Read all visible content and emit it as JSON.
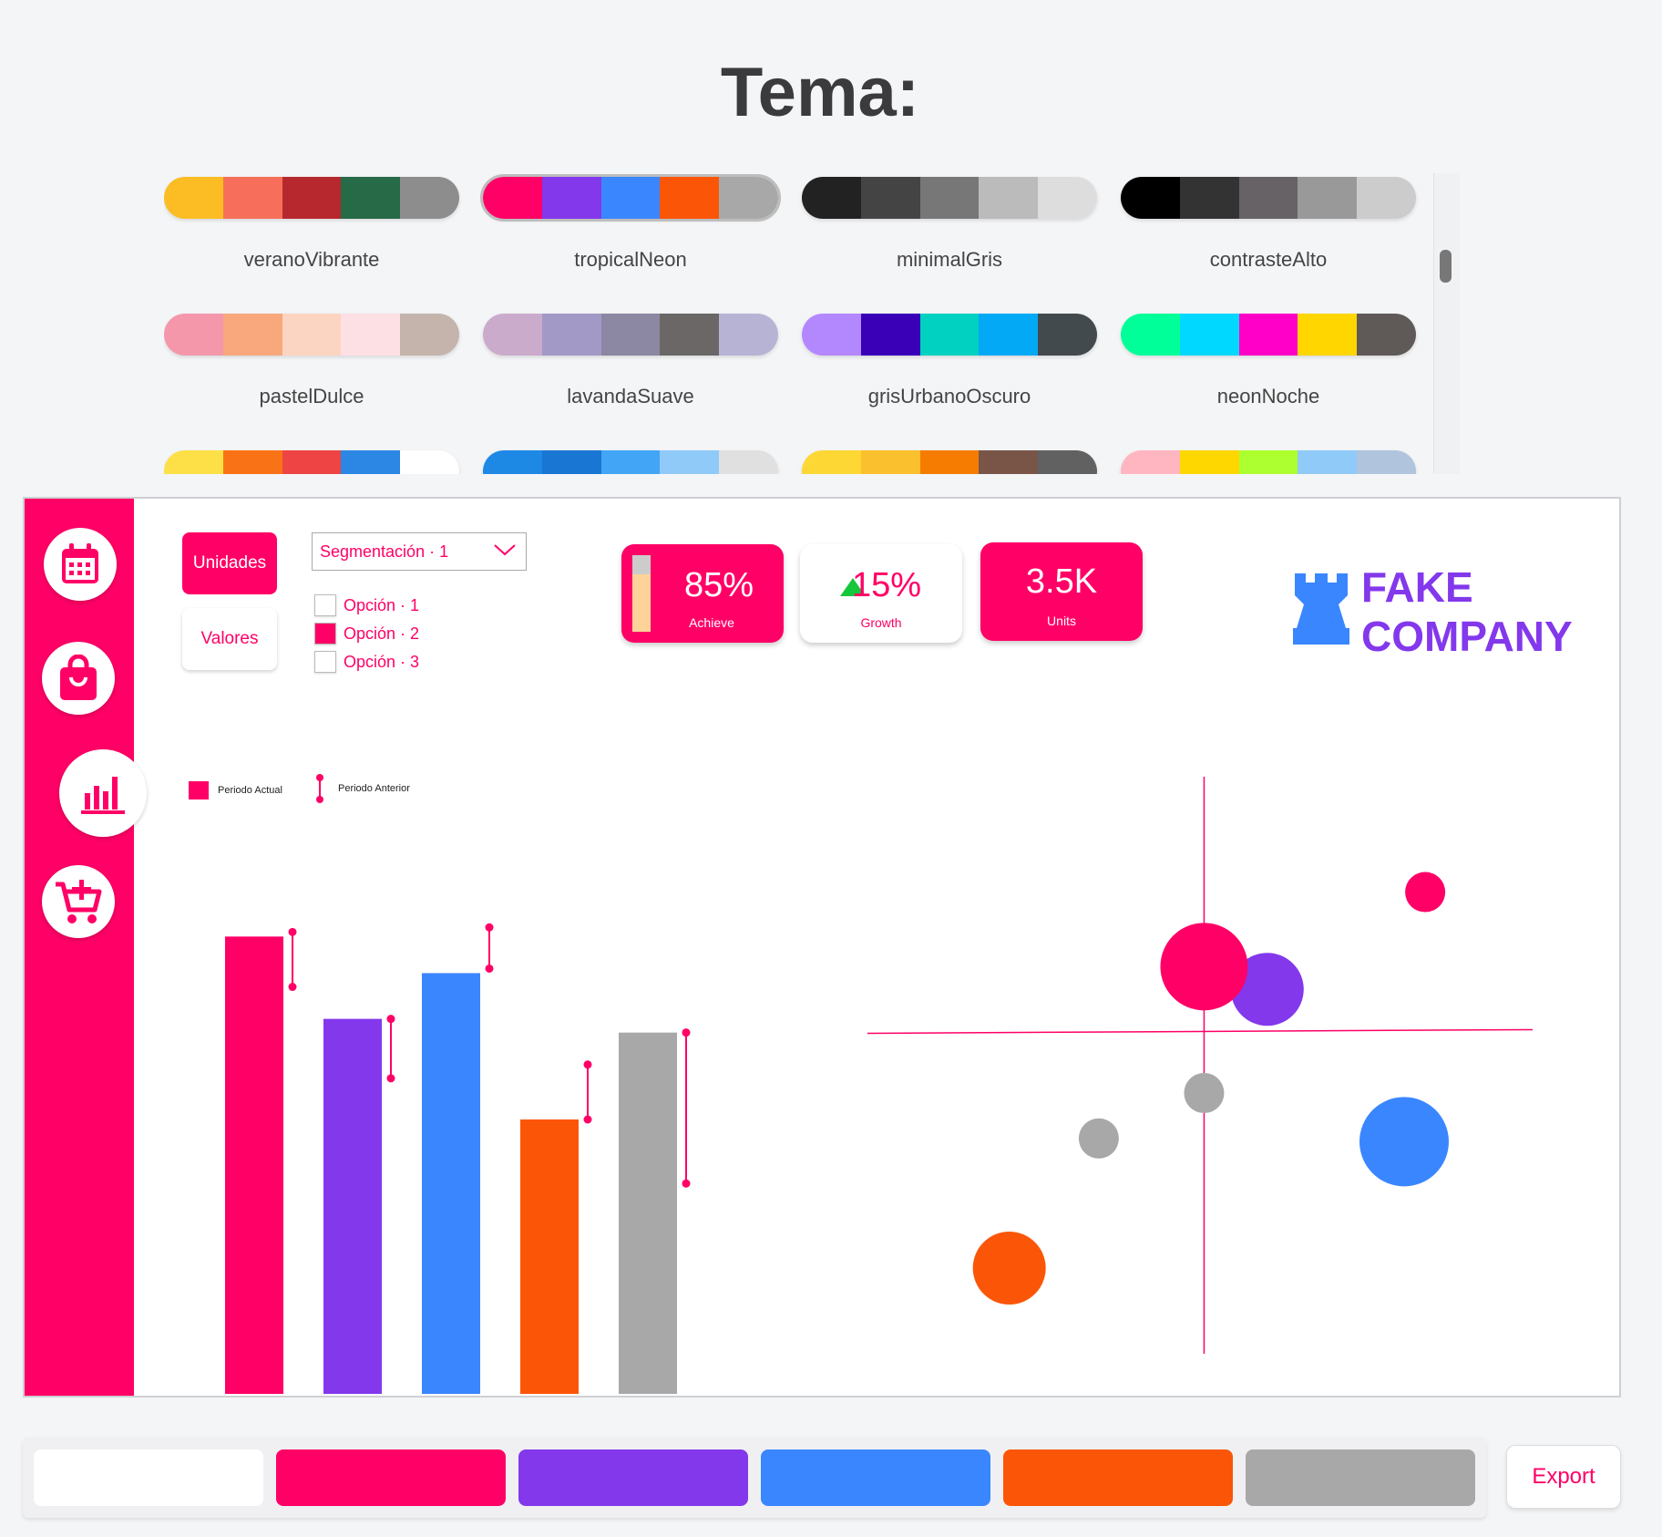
{
  "header": {
    "title": "Tema:"
  },
  "themes": [
    {
      "name": "veranoVibrante",
      "colors": [
        "#fbbd23",
        "#f76f5a",
        "#b7282e",
        "#276a47",
        "#8d8d8d"
      ]
    },
    {
      "name": "tropicalNeon",
      "colors": [
        "#ff0066",
        "#8338ec",
        "#3a86ff",
        "#fb5607",
        "#a8a8a8"
      ],
      "selected": true
    },
    {
      "name": "minimalGris",
      "colors": [
        "#222222",
        "#444444",
        "#777777",
        "#bbbbbb",
        "#dddddd"
      ]
    },
    {
      "name": "contrasteAlto",
      "colors": [
        "#000000",
        "#333333",
        "#666266",
        "#999999",
        "#cccccc"
      ]
    },
    {
      "name": "pastelDulce",
      "colors": [
        "#f497ab",
        "#f8a87c",
        "#fcd5c2",
        "#fde0e4",
        "#c4b4ab"
      ]
    },
    {
      "name": "lavandaSuave",
      "colors": [
        "#cbabcc",
        "#a399c6",
        "#8c87a2",
        "#6b6767",
        "#b7b3d4"
      ]
    },
    {
      "name": "grisUrbanoOscuro",
      "colors": [
        "#b388ff",
        "#3a00b8",
        "#00d1c1",
        "#03a9f4",
        "#424a4d"
      ]
    },
    {
      "name": "neonNoche",
      "colors": [
        "#00ff99",
        "#00d8ff",
        "#ff00c8",
        "#ffd600",
        "#5f5a58"
      ]
    },
    {
      "name": "",
      "colors": [
        "#fde047",
        "#f97316",
        "#ef4444",
        "#2b87e3",
        "#ffffff"
      ]
    },
    {
      "name": "",
      "colors": [
        "#1e88e5",
        "#1976d2",
        "#42a5f5",
        "#90caf9",
        "#e0e0e0"
      ]
    },
    {
      "name": "",
      "colors": [
        "#fdd835",
        "#fbc02d",
        "#f57c00",
        "#795548",
        "#616161"
      ]
    },
    {
      "name": "",
      "colors": [
        "#ffb6c1",
        "#ffd700",
        "#adff2f",
        "#90caf9",
        "#b0c4de"
      ]
    }
  ],
  "accent": "#ff0066",
  "sidebar": {
    "items": [
      {
        "name": "calendar-icon"
      },
      {
        "name": "shopping-bag-icon"
      },
      {
        "name": "bar-chart-icon",
        "active": true
      },
      {
        "name": "cart-add-icon"
      }
    ]
  },
  "controls": {
    "unidades": "Unidades",
    "valores": "Valores",
    "segmentacion": "Segmentación · 1",
    "options": [
      {
        "label": "Opción · 1",
        "checked": false
      },
      {
        "label": "Opción · 2",
        "checked": true
      },
      {
        "label": "Opción · 3",
        "checked": false
      }
    ]
  },
  "kpis": [
    {
      "value": "85%",
      "label": "Achieve",
      "progress": 0.75
    },
    {
      "value": "15%",
      "label": "Growth",
      "trend": "up"
    },
    {
      "value": "3.5K",
      "label": "Units"
    }
  ],
  "logo": {
    "line1": "FAKE",
    "line2": "COMPANY"
  },
  "chart_data": [
    {
      "type": "bar",
      "legend": [
        "Periodo Actual",
        "Periodo Anterior"
      ],
      "colors": [
        "#ff0066",
        "#8338ec",
        "#3a86ff",
        "#fb5607",
        "#a8a8a8"
      ],
      "series": [
        {
          "name": "Periodo Actual",
          "values": [
            100,
            82,
            92,
            60,
            79
          ]
        },
        {
          "name": "Periodo Anterior",
          "ranges": [
            [
              89,
              101
            ],
            [
              69,
              82
            ],
            [
              93,
              102
            ],
            [
              60,
              72
            ],
            [
              46,
              79
            ]
          ]
        }
      ],
      "ylim": [
        0,
        120
      ]
    },
    {
      "type": "scatter",
      "points": [
        {
          "x": 0,
          "y": 20,
          "r": 48,
          "color": "#ff0066"
        },
        {
          "x": 12,
          "y": 13,
          "r": 40,
          "color": "#8338ec"
        },
        {
          "x": 42,
          "y": 43,
          "r": 22,
          "color": "#ff0066"
        },
        {
          "x": 0,
          "y": -19,
          "r": 22,
          "color": "#a8a8a8"
        },
        {
          "x": -20,
          "y": -33,
          "r": 22,
          "color": "#a8a8a8"
        },
        {
          "x": 38,
          "y": -34,
          "r": 49,
          "color": "#3a86ff"
        },
        {
          "x": -37,
          "y": -73,
          "r": 40,
          "color": "#fb5607"
        }
      ],
      "xlim": [
        -70,
        65
      ],
      "ylim": [
        -100,
        80
      ]
    }
  ],
  "bottom": {
    "palette": [
      "#ffffff",
      "#ff0066",
      "#8338ec",
      "#3a86ff",
      "#fb5607",
      "#a8a8a8"
    ],
    "export_label": "Export"
  }
}
